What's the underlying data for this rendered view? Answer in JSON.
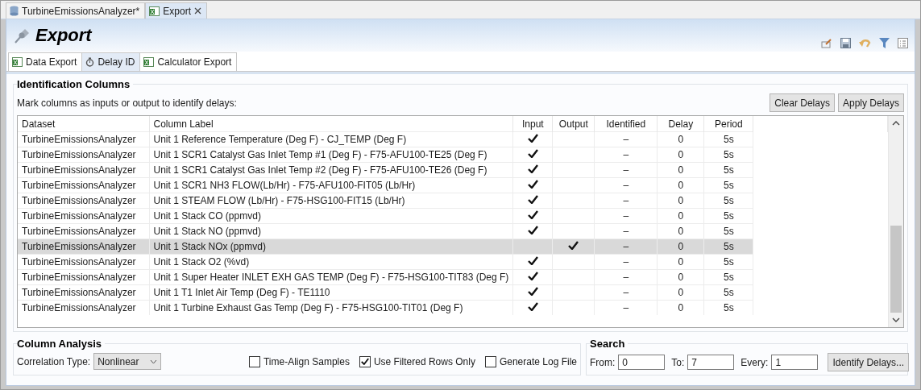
{
  "editor_tabs": [
    {
      "label": "TurbineEmissionsAnalyzer*",
      "kind": "database",
      "selected": false,
      "closable": false
    },
    {
      "label": "Export",
      "kind": "sheet",
      "selected": true,
      "closable": true
    }
  ],
  "header": {
    "title": "Export"
  },
  "view_tabs": [
    {
      "label": "Data Export",
      "kind": "sheet",
      "selected": false
    },
    {
      "label": "Delay ID",
      "kind": "timer",
      "selected": true
    },
    {
      "label": "Calculator Export",
      "kind": "sheet",
      "selected": false
    }
  ],
  "identification": {
    "title": "Identification Columns",
    "instructions": "Mark columns as inputs or output to identify delays:",
    "buttons": [
      "Clear Delays",
      "Apply Delays"
    ]
  },
  "table": {
    "columns": [
      "Dataset",
      "Column Label",
      "Input",
      "Output",
      "Identified",
      "Delay",
      "Period"
    ],
    "rows": [
      {
        "dataset": "TurbineEmissionsAnalyzer",
        "label": "Unit 1 Reference Temperature (Deg F) - CJ_TEMP (Deg F)",
        "input": true,
        "output": false,
        "identified": "–",
        "delay": "0",
        "period": "5s",
        "selected": false
      },
      {
        "dataset": "TurbineEmissionsAnalyzer",
        "label": "Unit 1 SCR1 Catalyst Gas Inlet Temp #1 (Deg F) - F75-AFU100-TE25 (Deg F)",
        "input": true,
        "output": false,
        "identified": "–",
        "delay": "0",
        "period": "5s",
        "selected": false
      },
      {
        "dataset": "TurbineEmissionsAnalyzer",
        "label": "Unit 1 SCR1 Catalyst Gas Inlet Temp #2 (Deg F) - F75-AFU100-TE26 (Deg F)",
        "input": true,
        "output": false,
        "identified": "–",
        "delay": "0",
        "period": "5s",
        "selected": false
      },
      {
        "dataset": "TurbineEmissionsAnalyzer",
        "label": "Unit 1 SCR1 NH3 FLOW(Lb/Hr) - F75-AFU100-FIT05 (Lb/Hr)",
        "input": true,
        "output": false,
        "identified": "–",
        "delay": "0",
        "period": "5s",
        "selected": false
      },
      {
        "dataset": "TurbineEmissionsAnalyzer",
        "label": "Unit 1 STEAM FLOW (Lb/Hr) - F75-HSG100-FIT15 (Lb/Hr)",
        "input": true,
        "output": false,
        "identified": "–",
        "delay": "0",
        "period": "5s",
        "selected": false
      },
      {
        "dataset": "TurbineEmissionsAnalyzer",
        "label": "Unit 1 Stack CO (ppmvd)",
        "input": true,
        "output": false,
        "identified": "–",
        "delay": "0",
        "period": "5s",
        "selected": false
      },
      {
        "dataset": "TurbineEmissionsAnalyzer",
        "label": "Unit 1 Stack NO (ppmvd)",
        "input": true,
        "output": false,
        "identified": "–",
        "delay": "0",
        "period": "5s",
        "selected": false
      },
      {
        "dataset": "TurbineEmissionsAnalyzer",
        "label": "Unit 1 Stack NOx (ppmvd)",
        "input": false,
        "output": true,
        "identified": "–",
        "delay": "0",
        "period": "5s",
        "selected": true
      },
      {
        "dataset": "TurbineEmissionsAnalyzer",
        "label": "Unit 1 Stack O2 (%vd)",
        "input": true,
        "output": false,
        "identified": "–",
        "delay": "0",
        "period": "5s",
        "selected": false
      },
      {
        "dataset": "TurbineEmissionsAnalyzer",
        "label": "Unit 1 Super Heater INLET EXH GAS TEMP (Deg F) - F75-HSG100-TIT83 (Deg F)",
        "input": true,
        "output": false,
        "identified": "–",
        "delay": "0",
        "period": "5s",
        "selected": false
      },
      {
        "dataset": "TurbineEmissionsAnalyzer",
        "label": "Unit 1 T1 Inlet Air Temp (Deg F) - TE1110",
        "input": true,
        "output": false,
        "identified": "–",
        "delay": "0",
        "period": "5s",
        "selected": false
      },
      {
        "dataset": "TurbineEmissionsAnalyzer",
        "label": "Unit 1 Turbine Exhaust Gas Temp (Deg F) - F75-HSG100-TIT01 (Deg F)",
        "input": true,
        "output": false,
        "identified": "–",
        "delay": "0",
        "period": "5s",
        "selected": false
      }
    ]
  },
  "column_analysis": {
    "title": "Column Analysis",
    "correlation_label": "Correlation Type:",
    "correlation_value": "Nonlinear",
    "options": [
      {
        "label": "Time-Align Samples",
        "checked": false
      },
      {
        "label": "Use Filtered Rows Only",
        "checked": true
      },
      {
        "label": "Generate Log File",
        "checked": false
      }
    ]
  },
  "search": {
    "title": "Search",
    "fields": [
      {
        "label": "From:",
        "value": "0"
      },
      {
        "label": "To:",
        "value": "7"
      },
      {
        "label": "Every:",
        "value": "1"
      }
    ],
    "button": "Identify Delays..."
  }
}
